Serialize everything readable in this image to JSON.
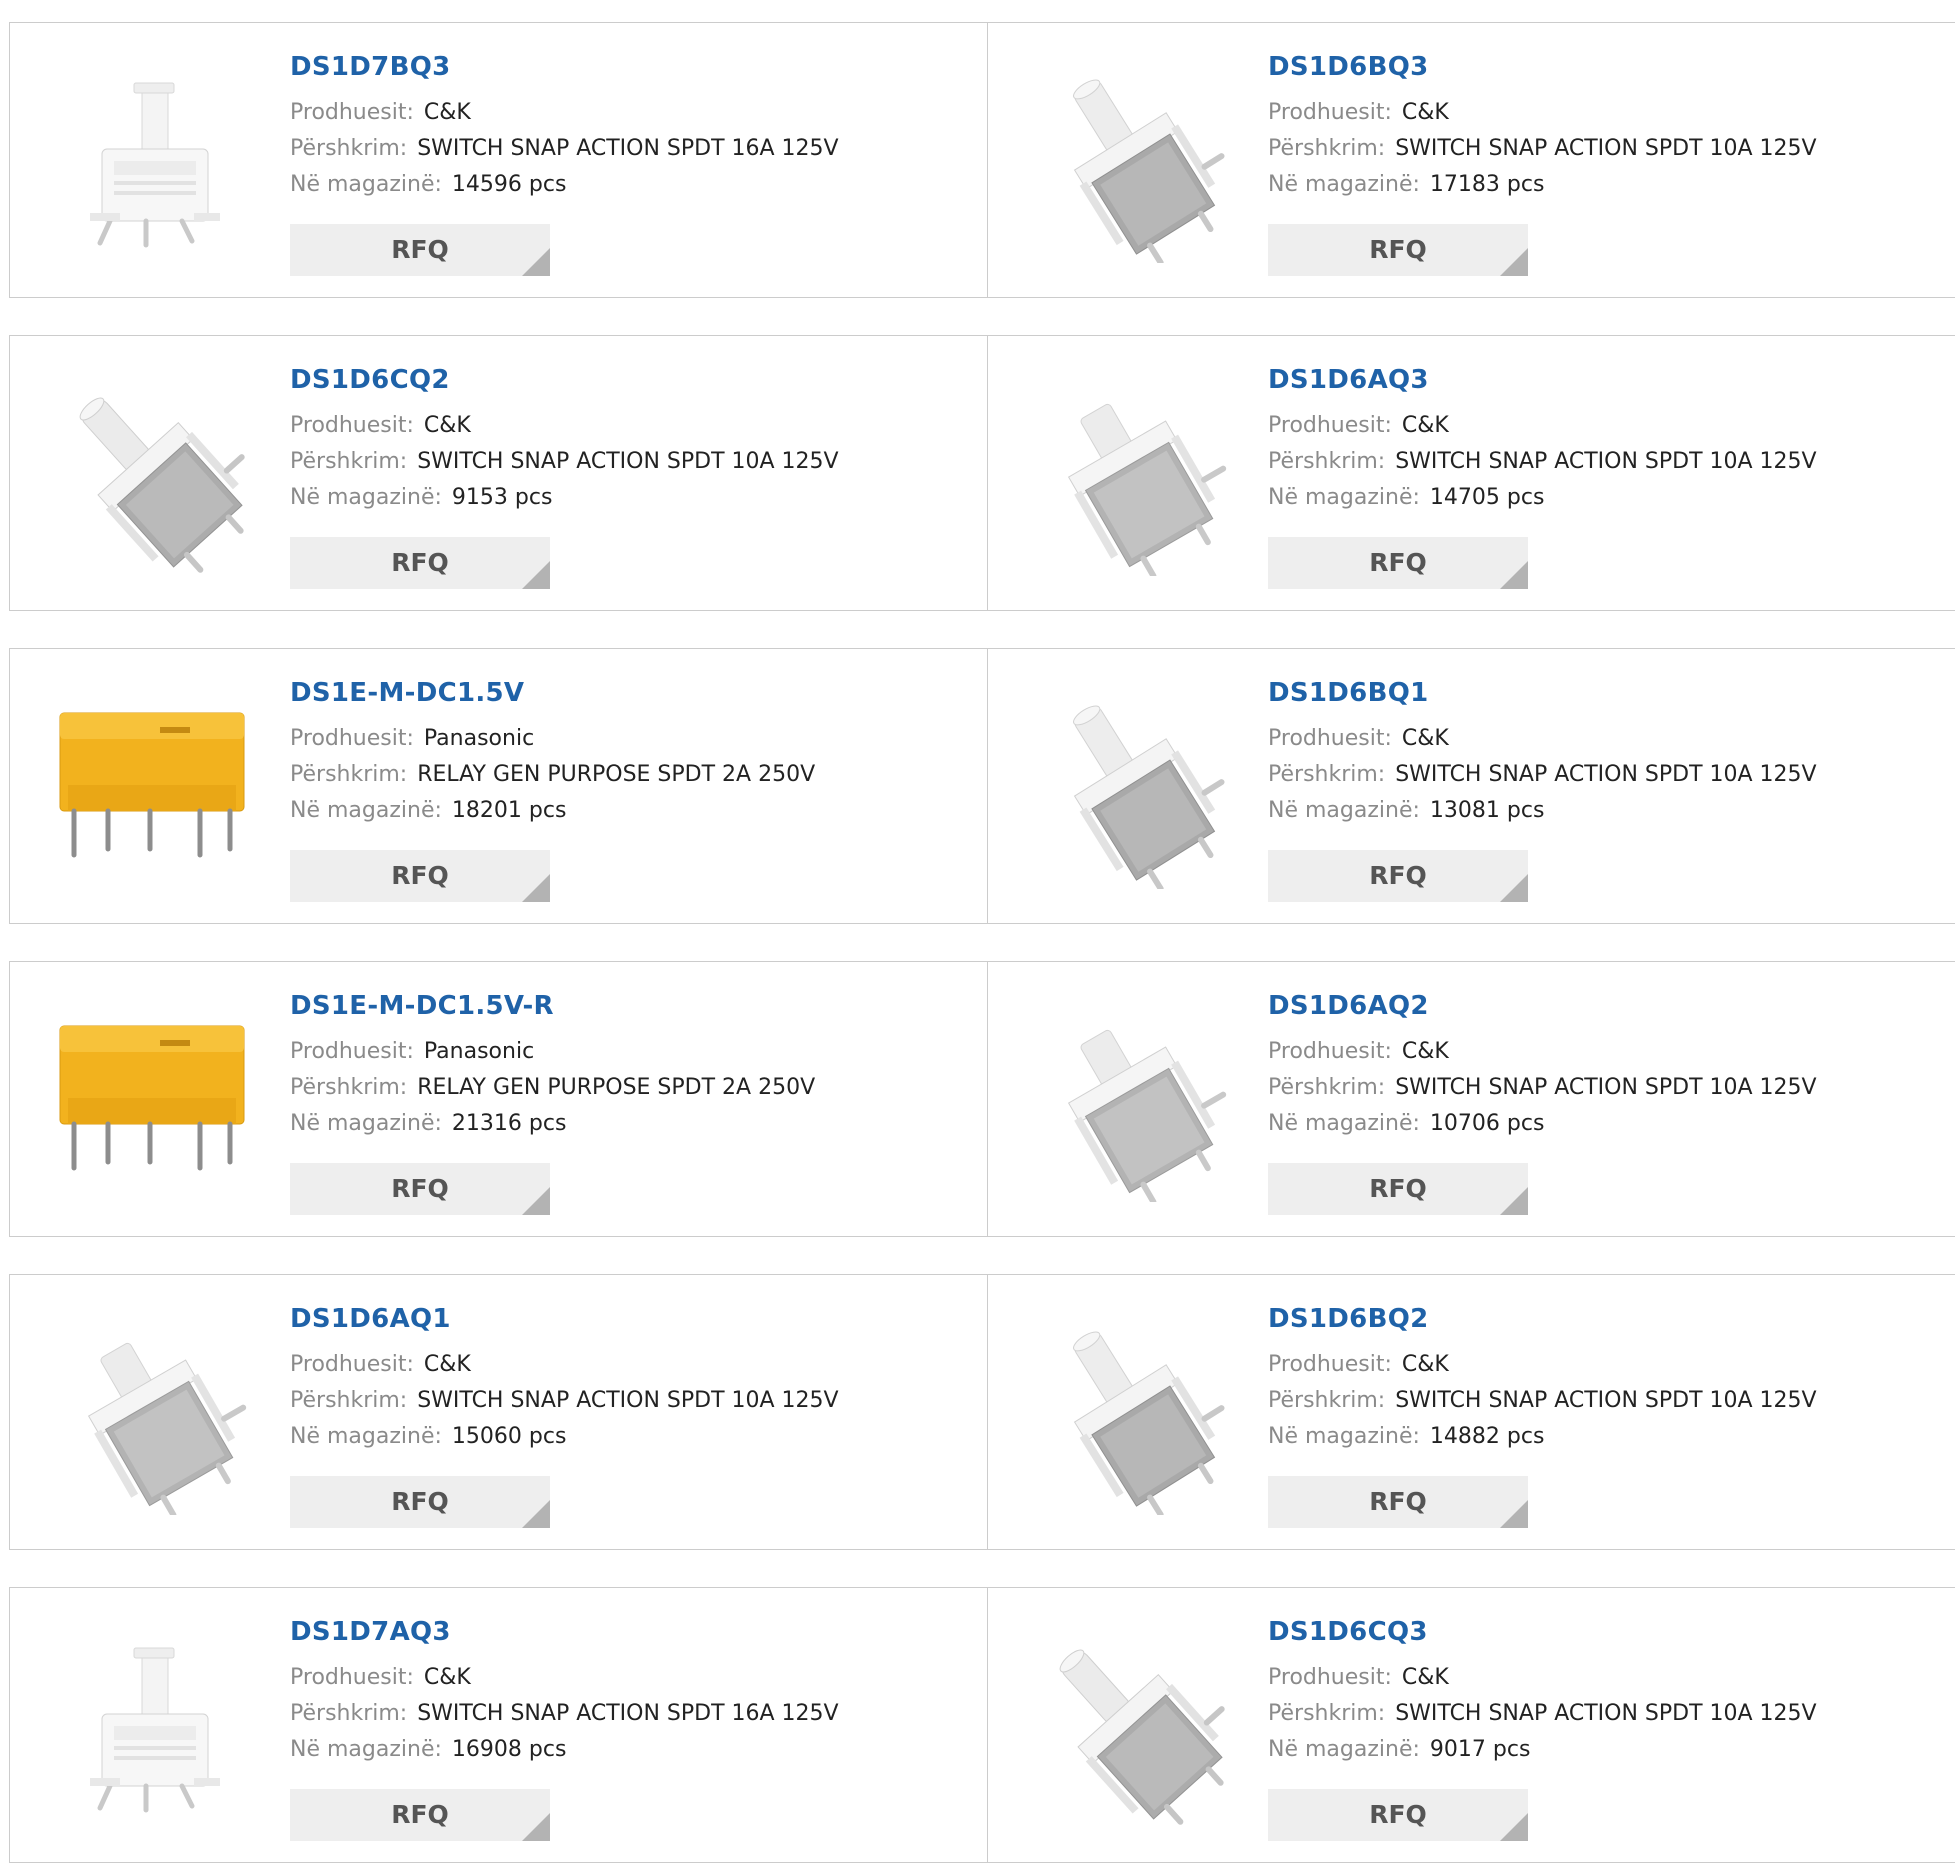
{
  "labels": {
    "manufacturer": "Prodhuesit:",
    "description": "Përshkrim:",
    "stock": "Në magazinë:",
    "rfq": "RFQ"
  },
  "colors": {
    "title": "#1f62a8",
    "rfq_bg": "#eeeeee",
    "border": "#cccccc"
  },
  "products": [
    {
      "part": "DS1D7BQ3",
      "manufacturer": "C&K",
      "description": "SWITCH SNAP ACTION SPDT 16A 125V",
      "stock": "14596 pcs",
      "image": "switch-upright"
    },
    {
      "part": "DS1D6BQ3",
      "manufacturer": "C&K",
      "description": "SWITCH SNAP ACTION SPDT 10A 125V",
      "stock": "17183 pcs",
      "image": "switch-angled"
    },
    {
      "part": "DS1D6CQ2",
      "manufacturer": "C&K",
      "description": "SWITCH SNAP ACTION SPDT 10A 125V",
      "stock": "9153 pcs",
      "image": "switch-tilted"
    },
    {
      "part": "DS1D6AQ3",
      "manufacturer": "C&K",
      "description": "SWITCH SNAP ACTION SPDT 10A 125V",
      "stock": "14705 pcs",
      "image": "switch-short"
    },
    {
      "part": "DS1E-M-DC1.5V",
      "manufacturer": "Panasonic",
      "description": "RELAY GEN PURPOSE SPDT 2A 250V",
      "stock": "18201 pcs",
      "image": "relay"
    },
    {
      "part": "DS1D6BQ1",
      "manufacturer": "C&K",
      "description": "SWITCH SNAP ACTION SPDT 10A 125V",
      "stock": "13081 pcs",
      "image": "switch-angled"
    },
    {
      "part": "DS1E-M-DC1.5V-R",
      "manufacturer": "Panasonic",
      "description": "RELAY GEN PURPOSE SPDT 2A 250V",
      "stock": "21316 pcs",
      "image": "relay"
    },
    {
      "part": "DS1D6AQ2",
      "manufacturer": "C&K",
      "description": "SWITCH SNAP ACTION SPDT 10A 125V",
      "stock": "10706 pcs",
      "image": "switch-short"
    },
    {
      "part": "DS1D6AQ1",
      "manufacturer": "C&K",
      "description": "SWITCH SNAP ACTION SPDT 10A 125V",
      "stock": "15060 pcs",
      "image": "switch-short"
    },
    {
      "part": "DS1D6BQ2",
      "manufacturer": "C&K",
      "description": "SWITCH SNAP ACTION SPDT 10A 125V",
      "stock": "14882 pcs",
      "image": "switch-angled"
    },
    {
      "part": "DS1D7AQ3",
      "manufacturer": "C&K",
      "description": "SWITCH SNAP ACTION SPDT 16A 125V",
      "stock": "16908 pcs",
      "image": "switch-upright"
    },
    {
      "part": "DS1D6CQ3",
      "manufacturer": "C&K",
      "description": "SWITCH SNAP ACTION SPDT 10A 125V",
      "stock": "9017 pcs",
      "image": "switch-tilted"
    }
  ]
}
